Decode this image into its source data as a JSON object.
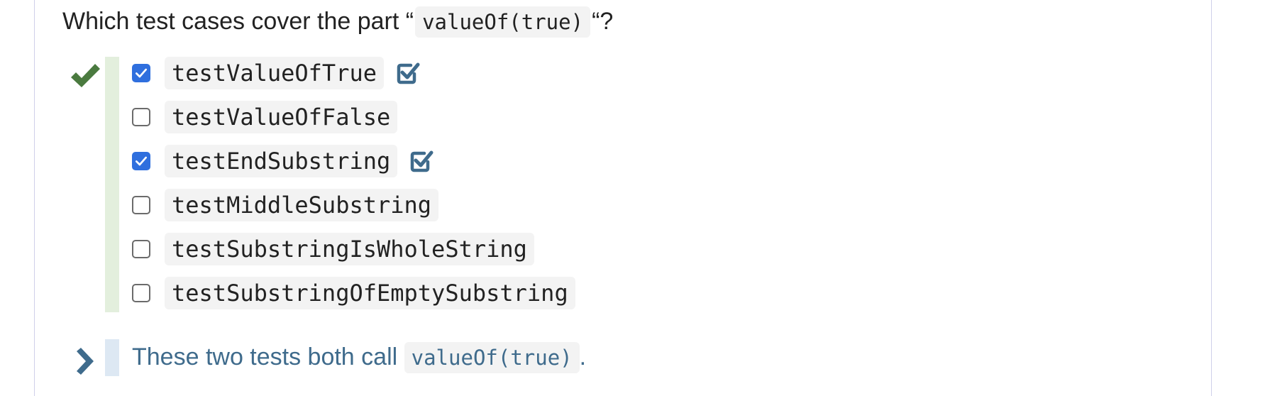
{
  "question": {
    "prefix": "Which test cases cover the part “",
    "code": "valueOf(true)",
    "suffix": "“?"
  },
  "result": {
    "status": "correct",
    "icon": "checkmark-icon",
    "color": "#4a7a3f"
  },
  "options": [
    {
      "label": "testValueOfTrue",
      "checked": true,
      "correct": true
    },
    {
      "label": "testValueOfFalse",
      "checked": false,
      "correct": false
    },
    {
      "label": "testEndSubstring",
      "checked": true,
      "correct": true
    },
    {
      "label": "testMiddleSubstring",
      "checked": false,
      "correct": false
    },
    {
      "label": "testSubstringIsWholeString",
      "checked": false,
      "correct": false
    },
    {
      "label": "testSubstringOfEmptySubstring",
      "checked": false,
      "correct": false
    }
  ],
  "hint": {
    "icon": "chevron-right-icon",
    "text": "These two tests both call ",
    "code": "valueOf(true)",
    "suffix": "."
  },
  "colors": {
    "checkbox_checked": "#2f6fde",
    "correct_badge": "#3f6b8c",
    "hint_text": "#3f6b8c",
    "success_bar": "#e3efdd",
    "hint_bar": "#dde8f3"
  }
}
